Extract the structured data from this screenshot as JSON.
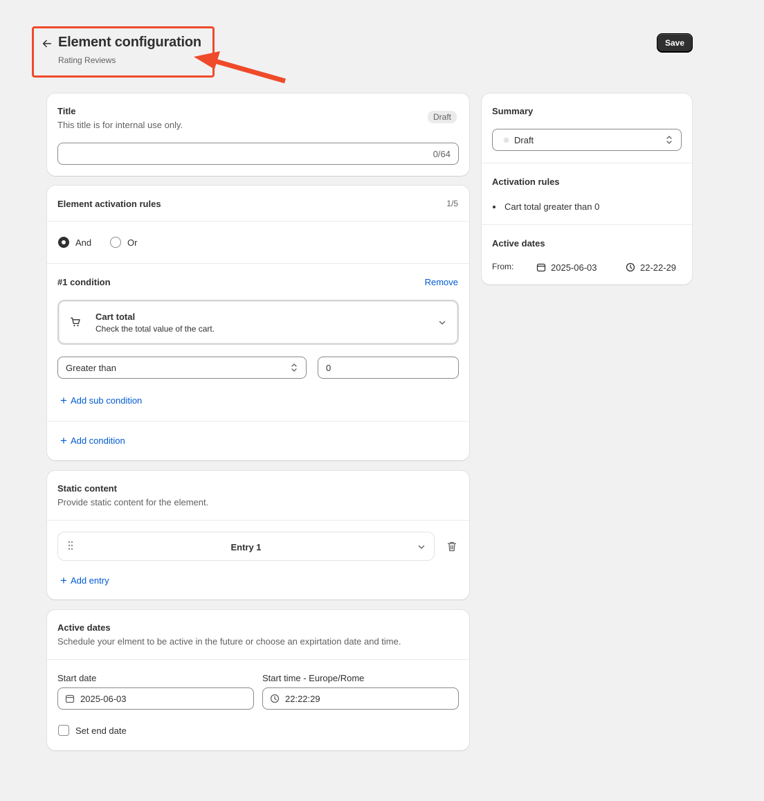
{
  "header": {
    "title": "Element configuration",
    "subtitle": "Rating Reviews",
    "save_label": "Save"
  },
  "title_card": {
    "heading": "Title",
    "description": "This title is for internal use only.",
    "badge": "Draft",
    "input_value": "",
    "char_count": "0/64"
  },
  "rules_card": {
    "heading": "Element activation rules",
    "count": "1/5",
    "logic_options": [
      {
        "label": "And",
        "selected": true
      },
      {
        "label": "Or",
        "selected": false
      }
    ],
    "condition_heading": "#1 condition",
    "remove_label": "Remove",
    "condition_type_title": "Cart total",
    "condition_type_desc": "Check the total value of the cart.",
    "operator": "Greater than",
    "value": "0",
    "add_sub_condition": "Add sub condition",
    "add_condition": "Add condition"
  },
  "static_card": {
    "heading": "Static content",
    "description": "Provide static content for the element.",
    "entry_label": "Entry 1",
    "add_entry": "Add entry"
  },
  "dates_card": {
    "heading": "Active dates",
    "description": "Schedule your elment to be active in the future or choose an expirtation date and time.",
    "start_date_label": "Start date",
    "start_date": "2025-06-03",
    "start_time_label": "Start time - Europe/Rome",
    "start_time": "22:22:29",
    "end_date_label": "Set end date"
  },
  "summary": {
    "heading": "Summary",
    "status": "Draft",
    "rules_heading": "Activation rules",
    "rules": [
      "Cart total greater than 0"
    ],
    "dates_heading": "Active dates",
    "from_label": "From:",
    "from_date": "2025-06-03",
    "from_time": "22-22-29"
  },
  "colors": {
    "annotation": "#ef4a2a",
    "link": "#005bd3",
    "primary_button": "#303030"
  }
}
